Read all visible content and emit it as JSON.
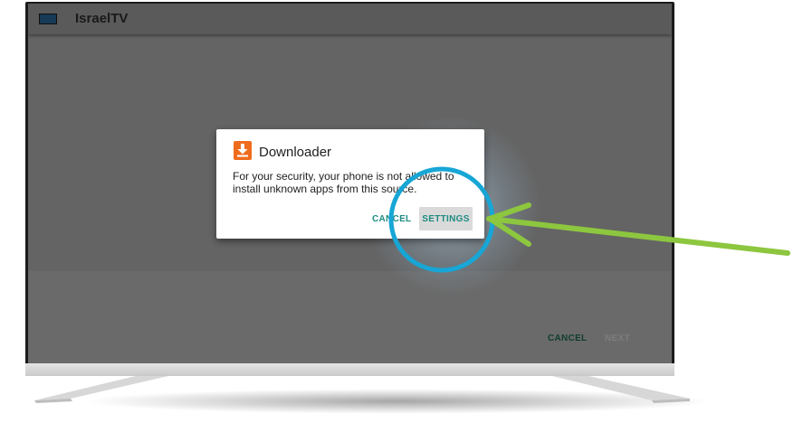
{
  "app_bar": {
    "title": "IsraelTV"
  },
  "dialog": {
    "title": "Downloader",
    "message": "For your security, your phone is not allowed to install unknown apps from this source.",
    "cancel_label": "CANCEL",
    "settings_label": "SETTINGS",
    "icon": "download-icon",
    "icon_color": "#ef6c1e"
  },
  "bottom_bar": {
    "cancel_label": "CANCEL",
    "next_label": "NEXT"
  },
  "annotations": {
    "highlight_circle_color": "#17a6d6",
    "arrow_color": "#8dc63f"
  },
  "colors": {
    "accent": "#1e8c82",
    "screen_bg": "#646464"
  }
}
